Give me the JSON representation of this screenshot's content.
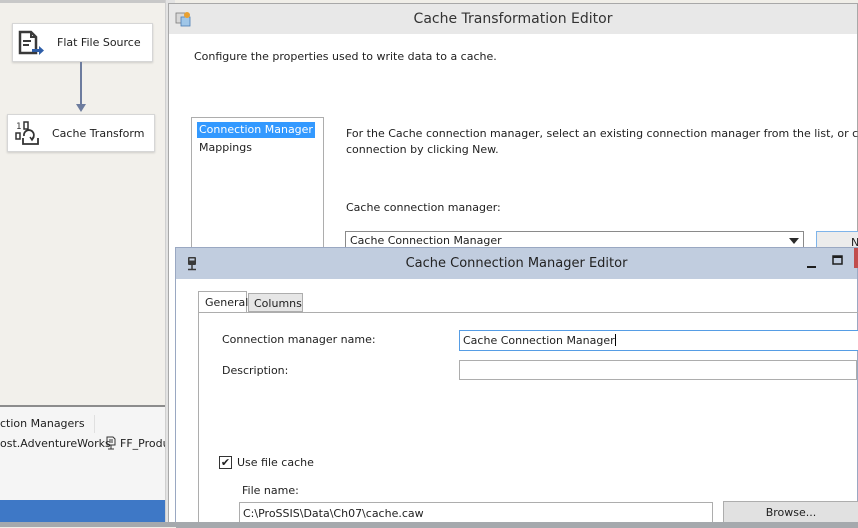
{
  "designer": {
    "tasks": [
      {
        "label": "Flat File Source",
        "icon": "flat-file-source-icon"
      },
      {
        "label": "Cache Transform",
        "icon": "cache-transform-icon"
      }
    ]
  },
  "connection_managers": {
    "tab_label": "ction Managers",
    "items": [
      {
        "label": "ost.AdventureWorks",
        "icon": "database-connection-icon"
      },
      {
        "label": "FF_Produ",
        "icon": "flat-file-connection-icon"
      }
    ]
  },
  "cache_transformation_editor": {
    "title": "Cache Transformation Editor",
    "description": "Configure the properties used to write data to a cache.",
    "nav": [
      {
        "label": "Connection Manager",
        "selected": true
      },
      {
        "label": "Mappings",
        "selected": false
      }
    ],
    "help_line1": "For the Cache connection manager, select an existing connection manager from the list, or create a new",
    "help_line2": "connection by clicking New.",
    "cache_cm_label": "Cache connection manager:",
    "cache_cm_value": "Cache Connection Manager",
    "new_button_label": "New..."
  },
  "cache_connection_manager_editor": {
    "title": "Cache Connection Manager Editor",
    "tabs": [
      {
        "label": "General",
        "active": true
      },
      {
        "label": "Columns",
        "active": false
      }
    ],
    "cm_name_label": "Connection manager name:",
    "cm_name_value": "Cache Connection Manager",
    "description_label": "Description:",
    "description_value": "",
    "use_file_cache_label": "Use file cache",
    "use_file_cache_checked": true,
    "checkmark": "✔",
    "file_name_label": "File name:",
    "file_name_value": "C:\\ProSSIS\\Data\\Ch07\\cache.caw",
    "browse_label": "Browse..."
  },
  "colors": {
    "selection": "#3399ff",
    "dialog_titlebar": "#c1cddf",
    "statusbar": "#3e78c6",
    "connector": "#6d7c9e"
  }
}
